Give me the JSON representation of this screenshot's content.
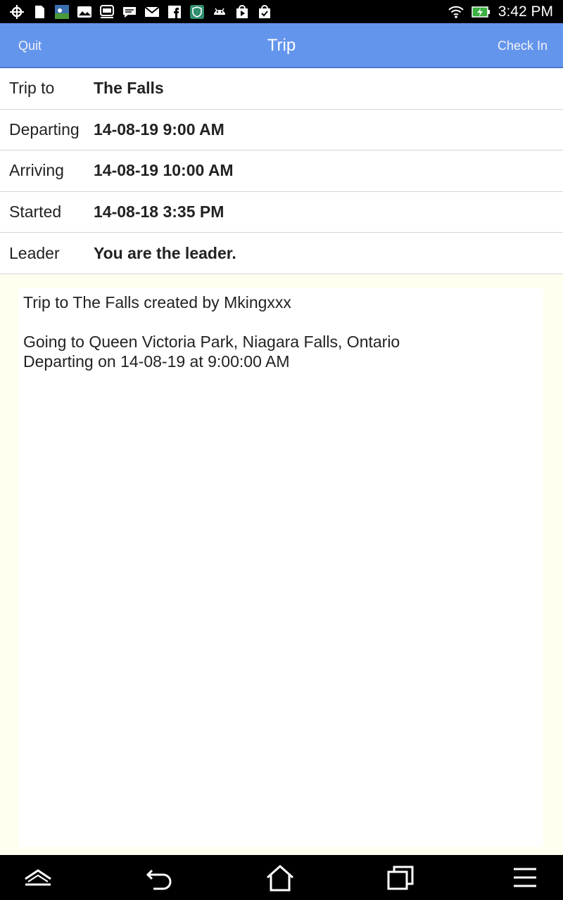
{
  "status_bar": {
    "time": "3:42 PM",
    "notification_icons": [
      "crosshair-icon",
      "sd-card-icon",
      "photo-app-icon",
      "gallery-icon",
      "gameloft-icon",
      "chat-icon",
      "mail-icon",
      "facebook-icon",
      "shield-app-icon",
      "android-icon",
      "play-store-icon",
      "task-check-icon"
    ],
    "right_icons": [
      "wifi-icon",
      "battery-charging-icon"
    ]
  },
  "header": {
    "quit_label": "Quit",
    "title": "Trip",
    "check_in_label": "Check In",
    "color": "#6495ed"
  },
  "details": [
    {
      "label": "Trip to",
      "value": "The Falls"
    },
    {
      "label": "Departing",
      "value": "14-08-19 9:00 AM"
    },
    {
      "label": "Arriving",
      "value": "14-08-19 10:00 AM"
    },
    {
      "label": "Started",
      "value": "14-08-18 3:35 PM"
    },
    {
      "label": "Leader",
      "value": "You are the leader."
    }
  ],
  "notes": {
    "line1": "Trip to The Falls created by Mkingxxx",
    "line2": "Going to Queen Victoria Park, Niagara Falls, Ontario",
    "line3": "Departing on 14-08-19 at 9:00:00 AM"
  },
  "nav_bar": {
    "buttons": [
      "collapse-icon",
      "back-icon",
      "home-icon",
      "recent-apps-icon",
      "menu-icon"
    ]
  }
}
